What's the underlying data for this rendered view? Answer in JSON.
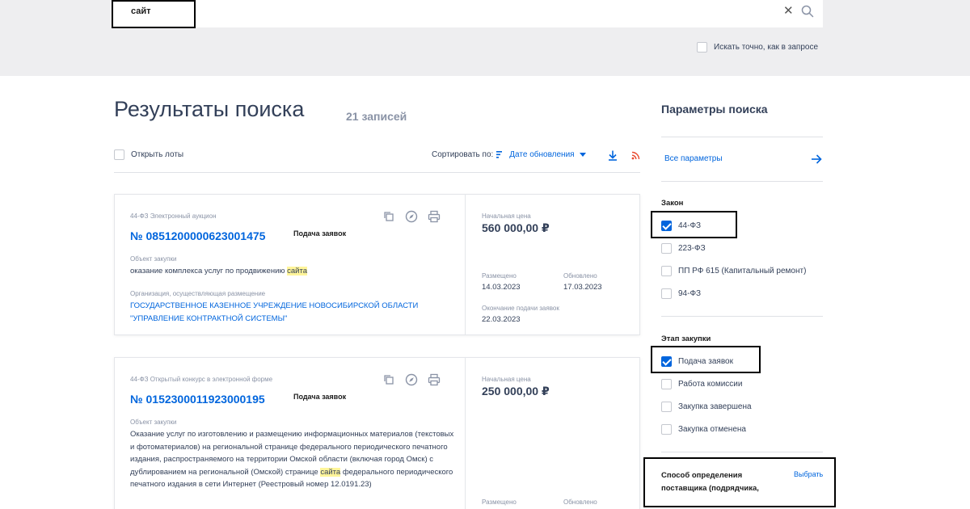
{
  "search": {
    "value": "сайт",
    "clear_icon": "close-icon",
    "search_icon": "search-icon",
    "exact_match_label": "Искать точно, как в запросе"
  },
  "results": {
    "title": "Результаты поиска",
    "count": "21 записей",
    "open_lots_label": "Открыть лоты",
    "sort_label": "Сортировать по:",
    "sort_value": "Дате обновления"
  },
  "cards": [
    {
      "purchase_type": "44-ФЗ Электронный аукцион",
      "reg_number": "№ 0851200000623001475",
      "stage": "Подача заявок",
      "object_label": "Объект закупки",
      "object_before": "оказание комплекса услуг по продвижению ",
      "object_highlight": "сайта",
      "object_after": "",
      "org_label": "Организация, осуществляющая размещение",
      "org_name": "ГОСУДАРСТВЕННОЕ КАЗЕННОЕ УЧРЕЖДЕНИЕ НОВОСИБИРСКОЙ ОБЛАСТИ \"УПРАВЛЕНИЕ КОНТРАКТНОЙ СИСТЕМЫ\"",
      "price_label": "Начальная цена",
      "price": "560 000,00 ₽",
      "placed_label": "Размещено",
      "placed": "14.03.2023",
      "updated_label": "Обновлено",
      "updated": "17.03.2023",
      "deadline_label": "Окончание подачи заявок",
      "deadline": "22.03.2023"
    },
    {
      "purchase_type": "44-ФЗ Открытый конкурс в электронной форме",
      "reg_number": "№ 0152300011923000195",
      "stage": "Подача заявок",
      "object_label": "Объект закупки",
      "object_before": "Оказание услуг по изготовлению и размещению информационных материалов (текстовых и фотоматериалов) на региональной странице федерального периодического печатного издания, распространяемого на территории Омской области (включая город Омск) с дублированием на региональной (Омской) странице ",
      "object_highlight": "сайта",
      "object_after": " федерального периодического печатного издания в сети Интернет (Реестровый номер 12.0191.23)",
      "price_label": "Начальная цена",
      "price": "250 000,00 ₽",
      "placed_label": "Размещено",
      "updated_label": "Обновлено"
    }
  ],
  "filters": {
    "title": "Параметры поиска",
    "all_params": "Все параметры",
    "law_heading": "Закон",
    "laws": [
      {
        "label": "44-ФЗ",
        "checked": true
      },
      {
        "label": "223-ФЗ",
        "checked": false
      },
      {
        "label": "ПП РФ 615 (Капитальный ремонт)",
        "checked": false
      },
      {
        "label": "94-ФЗ",
        "checked": false
      }
    ],
    "stage_heading": "Этап закупки",
    "stages": [
      {
        "label": "Подача заявок",
        "checked": true
      },
      {
        "label": "Работа комиссии",
        "checked": false
      },
      {
        "label": "Закупка завершена",
        "checked": false
      },
      {
        "label": "Закупка отменена",
        "checked": false
      }
    ],
    "method_heading": "Способ определения поставщика (подрядчика,",
    "choose_label": "Выбрать"
  },
  "colors": {
    "accent": "#0065dd",
    "text": "#334059",
    "muted": "#8a93a6",
    "highlight": "#fff59a",
    "rss": "#e8492e"
  }
}
